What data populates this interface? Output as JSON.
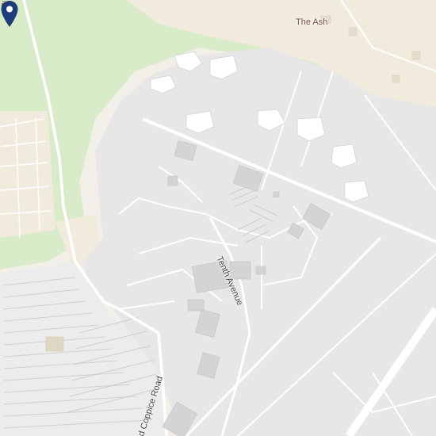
{
  "map": {
    "colors": {
      "background": "#f2efe9",
      "residential": "#f1ebde",
      "green": "#d9ecc9",
      "site": "#e7e7e8",
      "building": "#d4d4d6",
      "road": "#ffffff",
      "parking_lines": "#cfcfd2",
      "marker": "#1f3d7a"
    },
    "labels": {
      "poi": "The Ash",
      "road_1": "Tenth Avenue",
      "road_2": "d Coppice Road"
    },
    "icons": {
      "poi": "cafe-icon",
      "marker": "map-pin-icon"
    }
  }
}
